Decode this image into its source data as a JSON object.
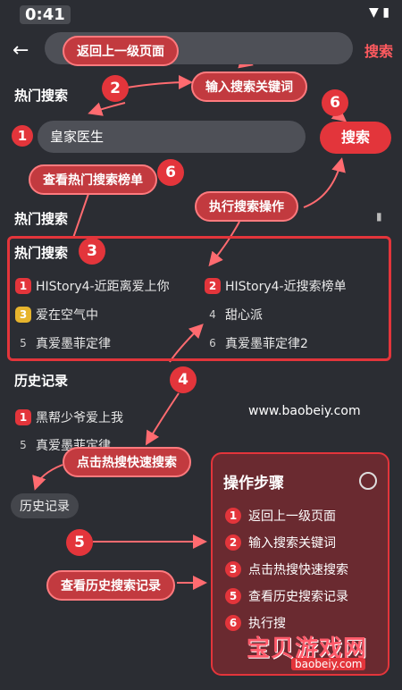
{
  "status": {
    "time": "0:41"
  },
  "topbar": {
    "search_label": "搜索"
  },
  "search": {
    "value": "皇家医生",
    "button": "搜索"
  },
  "sections": {
    "hot_search_1": "热门搜索",
    "hot_search_2": "热门搜索",
    "hot_search_box": "热门搜索",
    "history": "历史记录"
  },
  "hot_list": [
    {
      "rank": "1",
      "title": "HIStory4-近距离爱上你"
    },
    {
      "rank": "2",
      "title": "HIStory4-近搜索榜单"
    },
    {
      "rank": "3",
      "title": "爱在空气中"
    },
    {
      "rank": "4",
      "title": "甜心派"
    },
    {
      "rank": "5",
      "title": "真爱墨菲定律"
    },
    {
      "rank": "6",
      "title": "真爱墨菲定律2"
    }
  ],
  "history_list": [
    {
      "rank": "1",
      "title": "黑帮少爷爱上我"
    },
    {
      "rank": "5",
      "title": "真爱墨菲定律"
    }
  ],
  "history_chip": "历史记录",
  "callouts": {
    "back": "返回上一级页面",
    "input": "输入搜索关键词",
    "view_hot": "查看热门搜索榜单",
    "execute": "执行搜索操作",
    "click_hot": "点击热搜快速搜索",
    "view_history": "查看历史搜索记录"
  },
  "badges": {
    "b1": "1",
    "b2": "2",
    "b3": "3",
    "b4": "4",
    "b5": "5",
    "b6a": "6",
    "b6b": "6"
  },
  "steps": {
    "title": "操作步骤",
    "items": [
      {
        "n": "1",
        "text": "返回上一级页面"
      },
      {
        "n": "2",
        "text": "输入搜索关键词"
      },
      {
        "n": "3",
        "text": "点击热搜快速搜索"
      },
      {
        "n": "5",
        "text": "查看历史搜索记录"
      },
      {
        "n": "6",
        "text": "执行搜"
      }
    ]
  },
  "watermark": {
    "url": "www.baobeiy.com",
    "logo": "宝贝游戏网",
    "logo_sub": "baobeiy.com"
  },
  "colors": {
    "accent": "#e3353b",
    "background": "#2b2d33"
  }
}
